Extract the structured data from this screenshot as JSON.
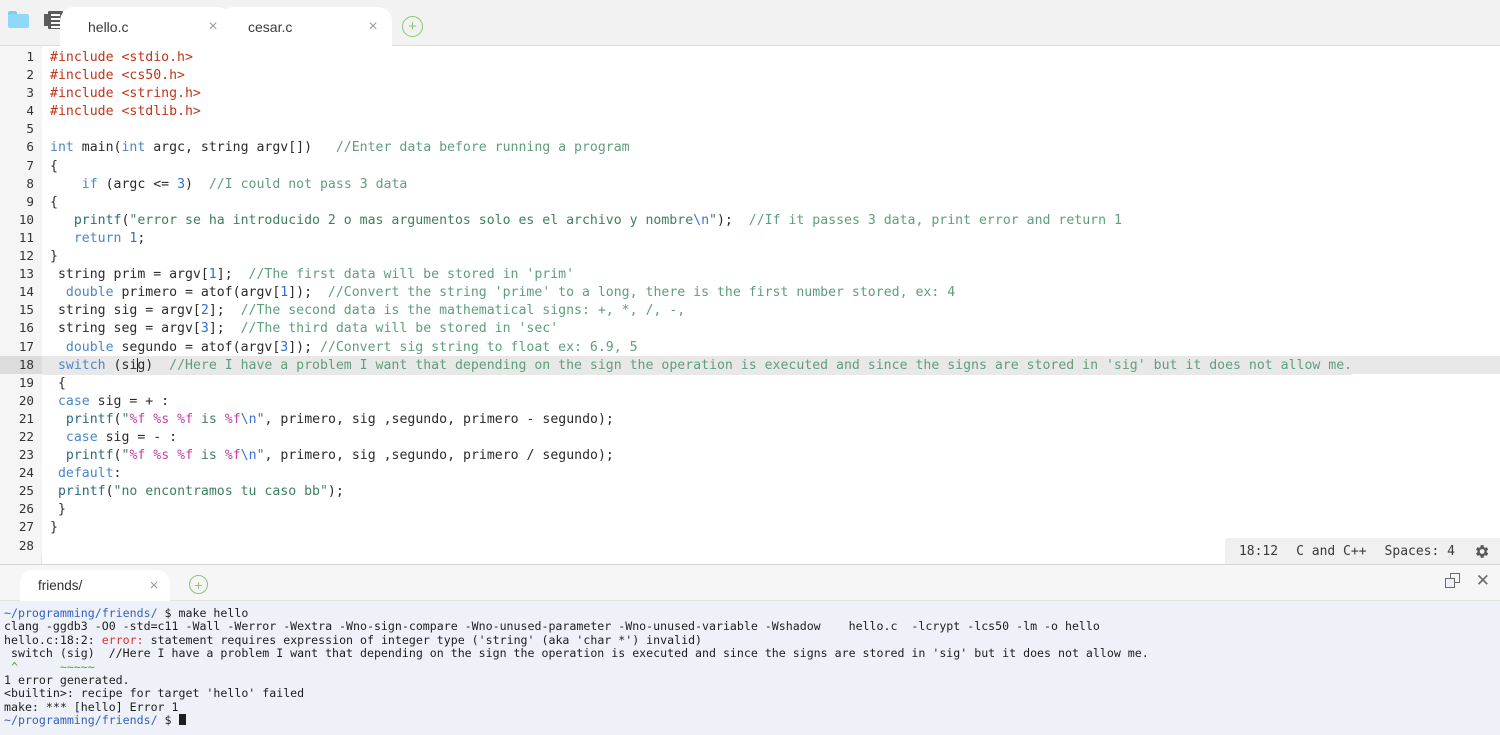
{
  "editor_tabbar": {
    "folder_icon": "folder-icon",
    "outline_icon": "outline-icon",
    "new_tab_label": "+",
    "tabs": [
      {
        "label": "hello.c",
        "close": "×",
        "active": true
      },
      {
        "label": "cesar.c",
        "close": "×",
        "active": false
      }
    ]
  },
  "code": {
    "language": "C",
    "active_line": 18,
    "lines": [
      {
        "n": "1",
        "tokens": [
          {
            "t": "#include ",
            "c": "t-pre"
          },
          {
            "t": "<stdio.h>",
            "c": "t-inc"
          }
        ]
      },
      {
        "n": "2",
        "tokens": [
          {
            "t": "#include ",
            "c": "t-pre"
          },
          {
            "t": "<cs50.h>",
            "c": "t-inc"
          }
        ]
      },
      {
        "n": "3",
        "tokens": [
          {
            "t": "#include ",
            "c": "t-pre"
          },
          {
            "t": "<string.h>",
            "c": "t-inc"
          }
        ]
      },
      {
        "n": "4",
        "tokens": [
          {
            "t": "#include ",
            "c": "t-pre"
          },
          {
            "t": "<stdlib.h>",
            "c": "t-inc"
          }
        ]
      },
      {
        "n": "5",
        "tokens": []
      },
      {
        "n": "6",
        "tokens": [
          {
            "t": "int",
            "c": "t-kw"
          },
          {
            "t": " main(",
            "c": ""
          },
          {
            "t": "int",
            "c": "t-kw"
          },
          {
            "t": " argc, string argv[])   ",
            "c": ""
          },
          {
            "t": "//Enter data before running a program",
            "c": "t-cmt"
          }
        ]
      },
      {
        "n": "7",
        "tokens": [
          {
            "t": "{",
            "c": ""
          }
        ]
      },
      {
        "n": "8",
        "tokens": [
          {
            "t": "    ",
            "c": ""
          },
          {
            "t": "if",
            "c": "t-kw"
          },
          {
            "t": " (argc <= ",
            "c": ""
          },
          {
            "t": "3",
            "c": "t-num"
          },
          {
            "t": ")  ",
            "c": ""
          },
          {
            "t": "//I could not pass 3 data",
            "c": "t-cmt"
          }
        ]
      },
      {
        "n": "9",
        "tokens": [
          {
            "t": "{",
            "c": ""
          }
        ]
      },
      {
        "n": "10",
        "tokens": [
          {
            "t": "   ",
            "c": ""
          },
          {
            "t": "printf",
            "c": "t-fn"
          },
          {
            "t": "(",
            "c": ""
          },
          {
            "t": "\"error se ha introducido 2 o mas argumentos solo es el archivo y nombre",
            "c": "t-str"
          },
          {
            "t": "\\n",
            "c": "t-esc"
          },
          {
            "t": "\"",
            "c": "t-str"
          },
          {
            "t": ");  ",
            "c": ""
          },
          {
            "t": "//If it passes 3 data, print error and return 1",
            "c": "t-cmt"
          }
        ]
      },
      {
        "n": "11",
        "tokens": [
          {
            "t": "   ",
            "c": ""
          },
          {
            "t": "return",
            "c": "t-kw"
          },
          {
            "t": " ",
            "c": ""
          },
          {
            "t": "1",
            "c": "t-num"
          },
          {
            "t": ";",
            "c": ""
          }
        ]
      },
      {
        "n": "12",
        "tokens": [
          {
            "t": "}",
            "c": ""
          }
        ]
      },
      {
        "n": "13",
        "tokens": [
          {
            "t": " string prim = argv[",
            "c": ""
          },
          {
            "t": "1",
            "c": "t-num"
          },
          {
            "t": "];  ",
            "c": ""
          },
          {
            "t": "//The first data will be stored in 'prim'",
            "c": "t-cmt"
          }
        ]
      },
      {
        "n": "14",
        "tokens": [
          {
            "t": "  ",
            "c": ""
          },
          {
            "t": "double",
            "c": "t-kw"
          },
          {
            "t": " primero = atof(argv[",
            "c": ""
          },
          {
            "t": "1",
            "c": "t-num"
          },
          {
            "t": "]);  ",
            "c": ""
          },
          {
            "t": "//Convert the string 'prime' to a long, there is the first number stored, ex: 4",
            "c": "t-cmt"
          }
        ]
      },
      {
        "n": "15",
        "tokens": [
          {
            "t": " string sig = argv[",
            "c": ""
          },
          {
            "t": "2",
            "c": "t-num"
          },
          {
            "t": "];  ",
            "c": ""
          },
          {
            "t": "//The second data is the mathematical signs: +, *, /, -,",
            "c": "t-cmt"
          }
        ]
      },
      {
        "n": "16",
        "tokens": [
          {
            "t": " string seg = argv[",
            "c": ""
          },
          {
            "t": "3",
            "c": "t-num"
          },
          {
            "t": "];  ",
            "c": ""
          },
          {
            "t": "//The third data will be stored in 'sec'",
            "c": "t-cmt"
          }
        ]
      },
      {
        "n": "17",
        "tokens": [
          {
            "t": "  ",
            "c": ""
          },
          {
            "t": "double",
            "c": "t-kw"
          },
          {
            "t": " segundo = atof(argv[",
            "c": ""
          },
          {
            "t": "3",
            "c": "t-num"
          },
          {
            "t": "]); ",
            "c": ""
          },
          {
            "t": "//Convert sig string to float ex: 6.9, 5",
            "c": "t-cmt"
          }
        ]
      },
      {
        "n": "18",
        "tokens": [
          {
            "t": " ",
            "c": ""
          },
          {
            "t": "switch",
            "c": "t-kw"
          },
          {
            "t": " (si",
            "c": ""
          },
          {
            "t": "|CARET|",
            "c": "caret"
          },
          {
            "t": "g)  ",
            "c": ""
          },
          {
            "t": "//Here I have a problem I want that depending on the sign the operation is executed and since the signs are stored in 'sig' but it does not allow me.",
            "c": "t-cmt"
          }
        ],
        "active": true
      },
      {
        "n": "19",
        "tokens": [
          {
            "t": " {",
            "c": ""
          }
        ]
      },
      {
        "n": "20",
        "tokens": [
          {
            "t": " ",
            "c": ""
          },
          {
            "t": "case",
            "c": "t-kw"
          },
          {
            "t": " sig = + :",
            "c": ""
          }
        ]
      },
      {
        "n": "21",
        "tokens": [
          {
            "t": "  ",
            "c": ""
          },
          {
            "t": "printf",
            "c": "t-fn"
          },
          {
            "t": "(",
            "c": ""
          },
          {
            "t": "\"",
            "c": "t-str"
          },
          {
            "t": "%f",
            "c": "t-fmt"
          },
          {
            "t": " ",
            "c": "t-str"
          },
          {
            "t": "%s",
            "c": "t-fmt"
          },
          {
            "t": " ",
            "c": "t-str"
          },
          {
            "t": "%f",
            "c": "t-fmt"
          },
          {
            "t": " is ",
            "c": "t-str"
          },
          {
            "t": "%f",
            "c": "t-fmt"
          },
          {
            "t": "\\n",
            "c": "t-esc"
          },
          {
            "t": "\"",
            "c": "t-str"
          },
          {
            "t": ", primero, sig ,segundo, primero - segundo);",
            "c": ""
          }
        ]
      },
      {
        "n": "22",
        "tokens": [
          {
            "t": "  ",
            "c": ""
          },
          {
            "t": "case",
            "c": "t-kw"
          },
          {
            "t": " sig = - :",
            "c": ""
          }
        ]
      },
      {
        "n": "23",
        "tokens": [
          {
            "t": "  ",
            "c": ""
          },
          {
            "t": "printf",
            "c": "t-fn"
          },
          {
            "t": "(",
            "c": ""
          },
          {
            "t": "\"",
            "c": "t-str"
          },
          {
            "t": "%f",
            "c": "t-fmt"
          },
          {
            "t": " ",
            "c": "t-str"
          },
          {
            "t": "%s",
            "c": "t-fmt"
          },
          {
            "t": " ",
            "c": "t-str"
          },
          {
            "t": "%f",
            "c": "t-fmt"
          },
          {
            "t": " is ",
            "c": "t-str"
          },
          {
            "t": "%f",
            "c": "t-fmt"
          },
          {
            "t": "\\n",
            "c": "t-esc"
          },
          {
            "t": "\"",
            "c": "t-str"
          },
          {
            "t": ", primero, sig ,segundo, primero / segundo);",
            "c": ""
          }
        ]
      },
      {
        "n": "24",
        "tokens": [
          {
            "t": " ",
            "c": ""
          },
          {
            "t": "default",
            "c": "t-kw"
          },
          {
            "t": ":",
            "c": ""
          }
        ]
      },
      {
        "n": "25",
        "tokens": [
          {
            "t": " ",
            "c": ""
          },
          {
            "t": "printf",
            "c": "t-fn"
          },
          {
            "t": "(",
            "c": ""
          },
          {
            "t": "\"no encontramos tu caso bb\"",
            "c": "t-str"
          },
          {
            "t": ");",
            "c": ""
          }
        ]
      },
      {
        "n": "26",
        "tokens": [
          {
            "t": " }",
            "c": ""
          }
        ]
      },
      {
        "n": "27",
        "tokens": [
          {
            "t": "}",
            "c": ""
          }
        ]
      },
      {
        "n": "28",
        "tokens": []
      }
    ]
  },
  "statusbar": {
    "cursor_position": "18:12",
    "language_mode": "C and C++",
    "indent_mode": "Spaces: 4",
    "settings_icon": "gear-icon"
  },
  "terminal": {
    "tabs": [
      {
        "label": "friends/",
        "close": "×",
        "active": true
      }
    ],
    "new_tab_label": "+",
    "maximize_icon": "maximize-icon",
    "close_icon": "close-icon",
    "lines": [
      {
        "segs": [
          {
            "t": "~/programming/friends/ ",
            "c": "term-path"
          },
          {
            "t": "$ make hello",
            "c": ""
          }
        ]
      },
      {
        "segs": [
          {
            "t": "clang -ggdb3 -O0 -std=c11 -Wall -Werror -Wextra -Wno-sign-compare -Wno-unused-parameter -Wno-unused-variable -Wshadow    hello.c  -lcrypt -lcs50 -lm -o hello",
            "c": ""
          }
        ]
      },
      {
        "segs": [
          {
            "t": "hello.c:18:2: ",
            "c": ""
          },
          {
            "t": "error:",
            "c": "term-err"
          },
          {
            "t": " statement requires expression of integer type ('string' (aka 'char *') invalid)",
            "c": ""
          }
        ]
      },
      {
        "segs": [
          {
            "t": " switch (sig)  //Here I have a problem I want that depending on the sign the operation is executed and since the signs are stored in 'sig' but it does not allow me.",
            "c": ""
          }
        ]
      },
      {
        "segs": [
          {
            "t": " ^      ~~~~~",
            "c": "term-green"
          }
        ]
      },
      {
        "segs": [
          {
            "t": "1 error generated.",
            "c": ""
          }
        ]
      },
      {
        "segs": [
          {
            "t": "<builtin>: recipe for target 'hello' failed",
            "c": ""
          }
        ]
      },
      {
        "segs": [
          {
            "t": "make: *** [hello] Error 1",
            "c": ""
          }
        ]
      },
      {
        "segs": [
          {
            "t": "~/programming/friends/ ",
            "c": "term-path"
          },
          {
            "t": "$ ",
            "c": ""
          },
          {
            "t": "|CURSOR|",
            "c": "cursor"
          }
        ]
      }
    ]
  }
}
